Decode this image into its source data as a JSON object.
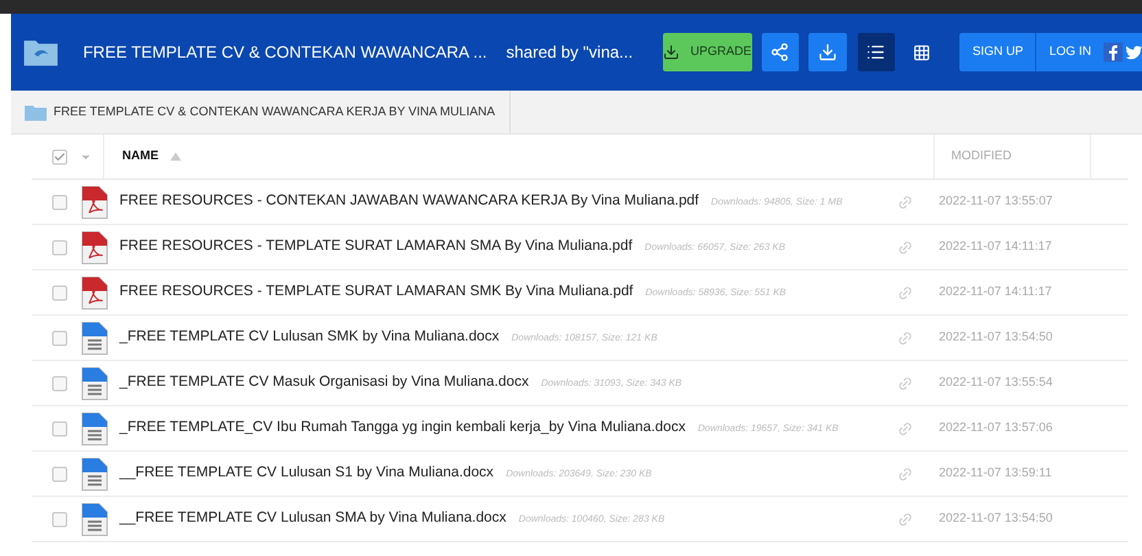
{
  "header": {
    "title": "FREE TEMPLATE CV & CONTEKAN WAWANCARA ...",
    "shared_by": "shared by \"vina...",
    "upgrade": "UPGRADE",
    "sign_up": "SIGN UP",
    "log_in": "LOG IN",
    "view_buttons": [
      {
        "kind": "list",
        "selected": true
      },
      {
        "kind": "grid",
        "selected": false
      }
    ]
  },
  "breadcrumb": "FREE TEMPLATE CV & CONTEKAN WAWANCARA KERJA BY VINA MULIANA",
  "table": {
    "select_all": {
      "checked": true
    },
    "columns": [
      {
        "label": "NAME",
        "sorted": true
      },
      {
        "label": "MODIFIED",
        "sorted": false
      }
    ],
    "rows": [
      {
        "kind": "pdf",
        "name": "FREE RESOURCES - CONTEKAN JAWABAN WAWANCARA KERJA By Vina Muliana.pdf",
        "meta": "Downloads: 94805, Size: 1 MB",
        "modified": "2022-11-07 13:55:07",
        "checked": false
      },
      {
        "kind": "pdf",
        "name": "FREE RESOURCES - TEMPLATE SURAT LAMARAN SMA By Vina Muliana.pdf",
        "meta": "Downloads: 66057, Size: 263 KB",
        "modified": "2022-11-07 14:11:17",
        "checked": false
      },
      {
        "kind": "pdf",
        "name": "FREE RESOURCES - TEMPLATE SURAT LAMARAN SMK By Vina Muliana.pdf",
        "meta": "Downloads: 58936, Size: 551 KB",
        "modified": "2022-11-07 14:11:17",
        "checked": false
      },
      {
        "kind": "doc",
        "name": "_FREE TEMPLATE CV Lulusan SMK by Vina Muliana.docx",
        "meta": "Downloads: 108157, Size: 121 KB",
        "modified": "2022-11-07 13:54:50",
        "checked": false
      },
      {
        "kind": "doc",
        "name": "_FREE TEMPLATE CV Masuk Organisasi by Vina Muliana.docx",
        "meta": "Downloads: 31093, Size: 343 KB",
        "modified": "2022-11-07 13:55:54",
        "checked": false
      },
      {
        "kind": "doc",
        "name": "_FREE TEMPLATE_CV Ibu Rumah Tangga yg ingin kembali kerja_by Vina Muliana.docx",
        "meta": "Downloads: 19657, Size: 341 KB",
        "modified": "2022-11-07 13:57:06",
        "checked": false
      },
      {
        "kind": "doc",
        "name": "__FREE TEMPLATE CV Lulusan S1 by Vina Muliana.docx",
        "meta": "Downloads: 203649, Size: 230 KB",
        "modified": "2022-11-07 13:59:11",
        "checked": false
      },
      {
        "kind": "doc",
        "name": "__FREE TEMPLATE CV Lulusan SMA by Vina Muliana.docx",
        "meta": "Downloads: 100460, Size: 283 KB",
        "modified": "2022-11-07 13:54:50",
        "checked": false
      }
    ]
  }
}
